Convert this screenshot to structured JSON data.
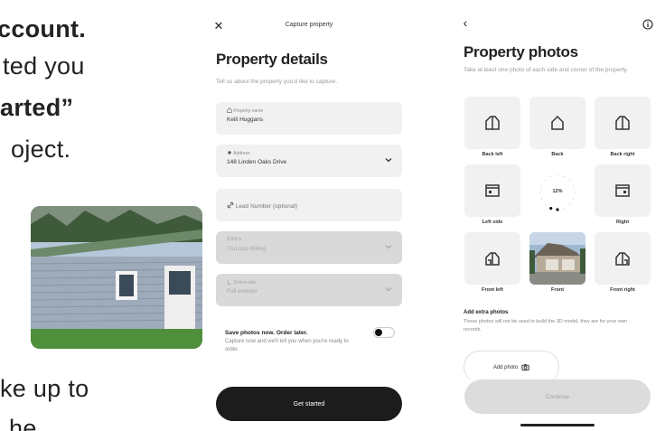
{
  "article": {
    "lines": [
      "ccount.",
      "ted you",
      "arted”",
      "oject.",
      "ke up to",
      "he"
    ]
  },
  "details_screen": {
    "close_icon": "close-icon",
    "header_title": "Capture property",
    "title": "Property details",
    "subtitle": "Tell us about the property you'd like to capture.",
    "fields": [
      {
        "label": "Property name",
        "value": "Kelli Huggans",
        "icon": "home-icon"
      },
      {
        "label": "Address",
        "value": "148 Linden Oaks Drive",
        "icon": "pin-icon"
      },
      {
        "label": "",
        "value": "Lead Number (optional)",
        "icon": "link-icon"
      },
      {
        "label": "Bill to",
        "value": "TruLoop Billing",
        "icon": "dollar-icon"
      },
      {
        "label": "Deliverable",
        "value": "Full exterior",
        "icon": "deliverable-icon"
      }
    ],
    "save_toggle": {
      "title": "Save photos now. Order later.",
      "description": "Capture now and we'll tell you when you're ready to order."
    },
    "primary_button": "Get started"
  },
  "photos_screen": {
    "back_icon": "chevron-left-icon",
    "info_icon": "info-icon",
    "title": "Property photos",
    "subtitle": "Take at least one photo of each side and corner of the property.",
    "tiles": [
      "Back left",
      "Back",
      "Back right",
      "Left side",
      "Right",
      "Front left",
      "Front",
      "Front right"
    ],
    "progress_percent": 12,
    "progress_text": "12%",
    "extra": {
      "title": "Add extra photos",
      "description": "These photos will not be used to build the 3D model, they are for your own records."
    },
    "add_photo_button": "Add photo",
    "continue_button": "Continue"
  },
  "colors": {
    "primary": "#1c1c1c",
    "field_bg": "#f1f1f1",
    "disabled_bg": "#d9d9d9",
    "continue_bg": "#dcdcdc"
  }
}
